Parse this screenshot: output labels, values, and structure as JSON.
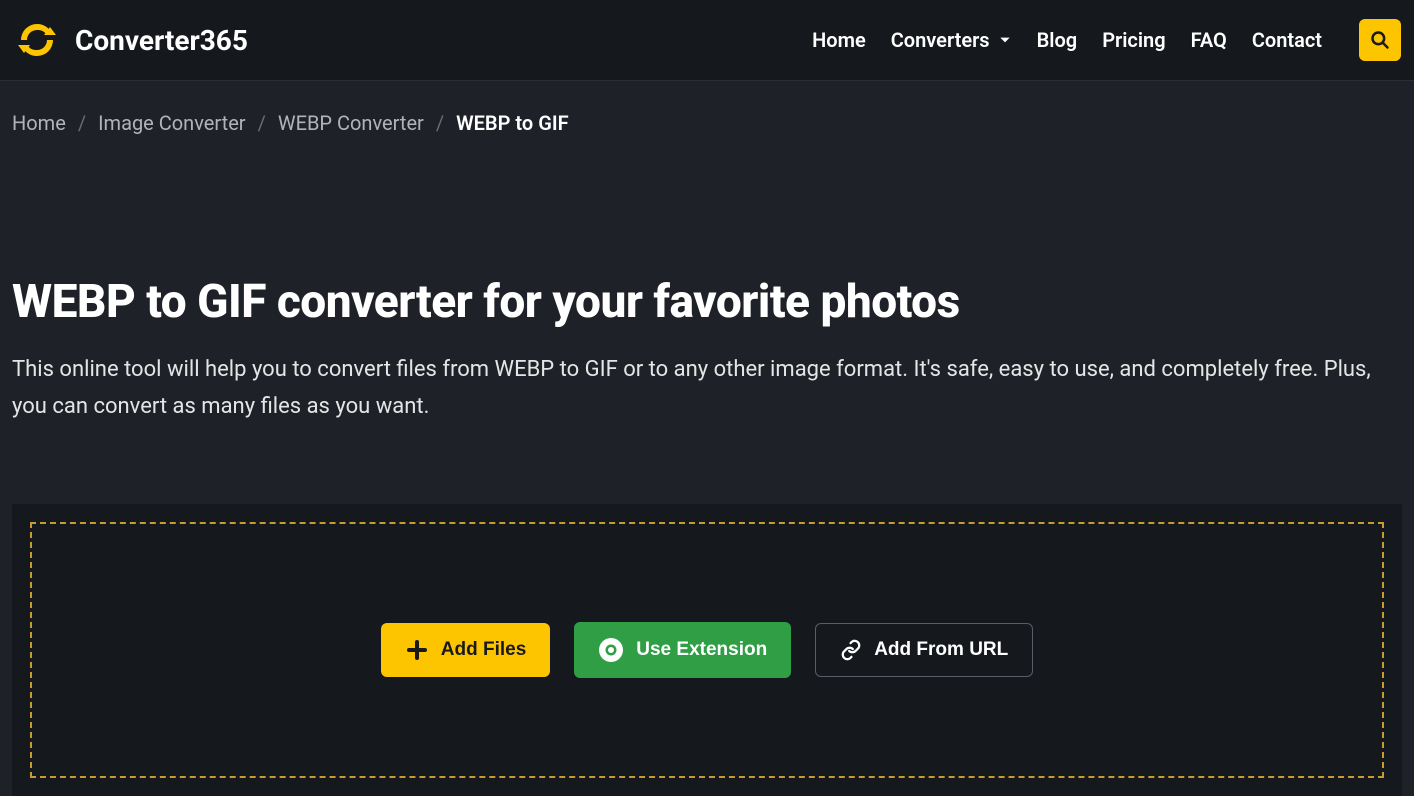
{
  "header": {
    "brand": "Converter365",
    "nav": {
      "home": "Home",
      "converters": "Converters",
      "blog": "Blog",
      "pricing": "Pricing",
      "faq": "FAQ",
      "contact": "Contact"
    }
  },
  "breadcrumb": {
    "items": [
      "Home",
      "Image Converter",
      "WEBP Converter"
    ],
    "current": "WEBP to GIF"
  },
  "hero": {
    "title": "WEBP to GIF converter for your favorite photos",
    "subtitle": "This online tool will help you to convert files from WEBP to GIF or to any other image format. It's safe, easy to use, and completely free. Plus, you can convert as many files as you want."
  },
  "upload": {
    "add_files": "Add Files",
    "use_extension": "Use Extension",
    "add_from_url": "Add From URL"
  },
  "colors": {
    "accent": "#fdc500",
    "green": "#2f9e44",
    "bg": "#1e2228",
    "panel": "#15181d"
  }
}
